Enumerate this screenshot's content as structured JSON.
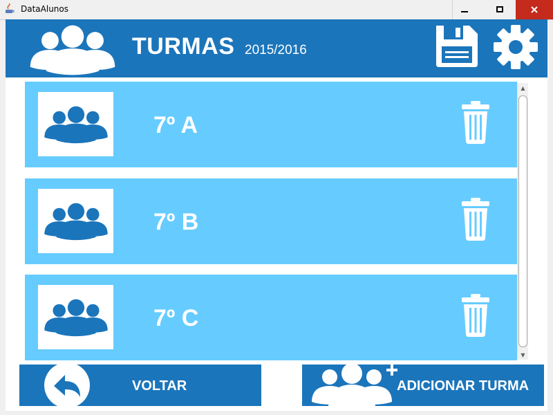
{
  "window": {
    "title": "DataAlunos"
  },
  "header": {
    "title": "TURMAS",
    "year": "2015/2016"
  },
  "classes": [
    {
      "label": "7º A"
    },
    {
      "label": "7º B"
    },
    {
      "label": "7º C"
    }
  ],
  "footer": {
    "back_label": "VOLTAR",
    "add_label": "ADICIONAR TURMA"
  },
  "colors": {
    "header_blue": "#1b75bb",
    "row_blue": "#66ccff",
    "white": "#ffffff",
    "close_red": "#c42b1c"
  },
  "icons": {
    "header": "group-icon",
    "save": "floppy-disk-icon",
    "settings": "gear-icon",
    "row": "group-icon",
    "delete": "trash-icon",
    "back": "back-arrow-icon",
    "add": "add-group-icon"
  }
}
